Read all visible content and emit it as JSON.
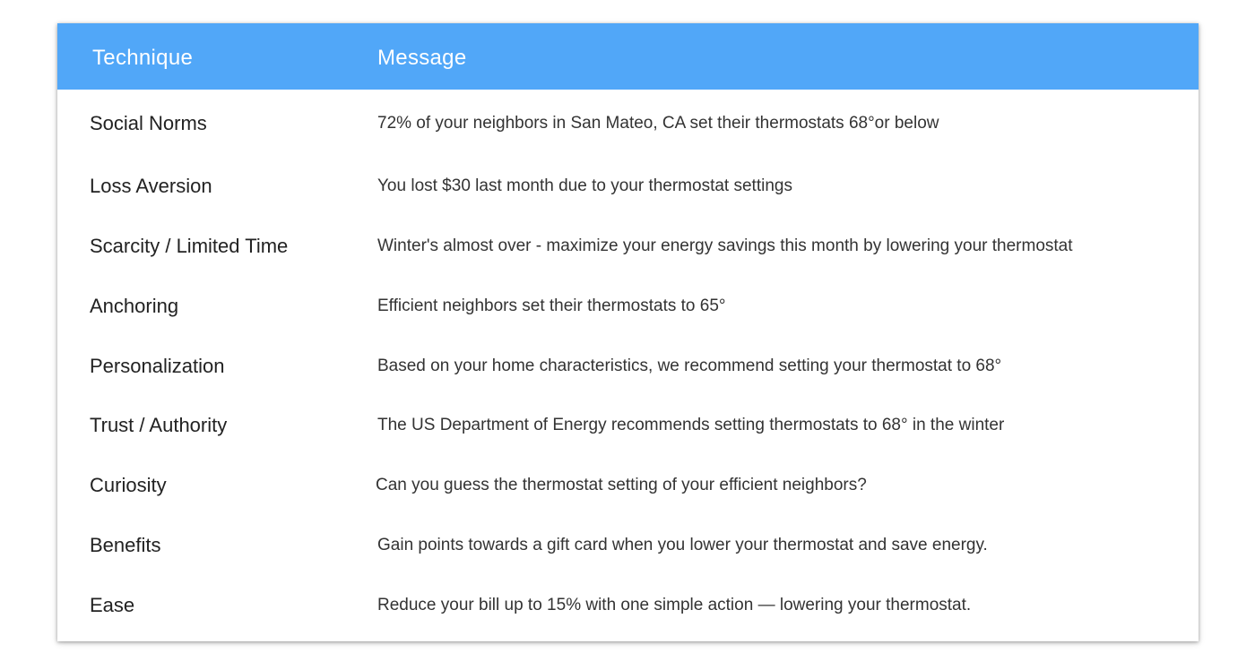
{
  "table": {
    "header": {
      "technique": "Technique",
      "message": "Message"
    },
    "rows": [
      {
        "technique": "Social Norms",
        "message": "72% of your neighbors in San Mateo, CA set their thermostats 68°or below"
      },
      {
        "technique": "Loss Aversion",
        "message": "You lost $30 last month due to your thermostat settings"
      },
      {
        "technique": "Scarcity / Limited Time",
        "message": "Winter's almost over - maximize your energy savings this month by lowering your thermostat"
      },
      {
        "technique": "Anchoring",
        "message": "Efficient neighbors set their thermostats to 65°"
      },
      {
        "technique": "Personalization",
        "message": "Based on your home characteristics, we recommend setting your thermostat to 68°"
      },
      {
        "technique": "Trust / Authority",
        "message": "The US Department of Energy recommends setting thermostats to 68° in the winter"
      },
      {
        "technique": "Curiosity",
        "message": "Can you guess the thermostat setting of your efficient neighbors?"
      },
      {
        "technique": "Benefits",
        "message": "Gain points towards a gift card when you lower your thermostat and save energy."
      },
      {
        "technique": "Ease",
        "message": "Reduce your bill up to 15% with one simple action — lowering your thermostat."
      }
    ]
  },
  "colors": {
    "header_background": "#51a7f8",
    "header_text": "#ffffff",
    "technique_text": "#222222",
    "message_text": "#333333"
  }
}
